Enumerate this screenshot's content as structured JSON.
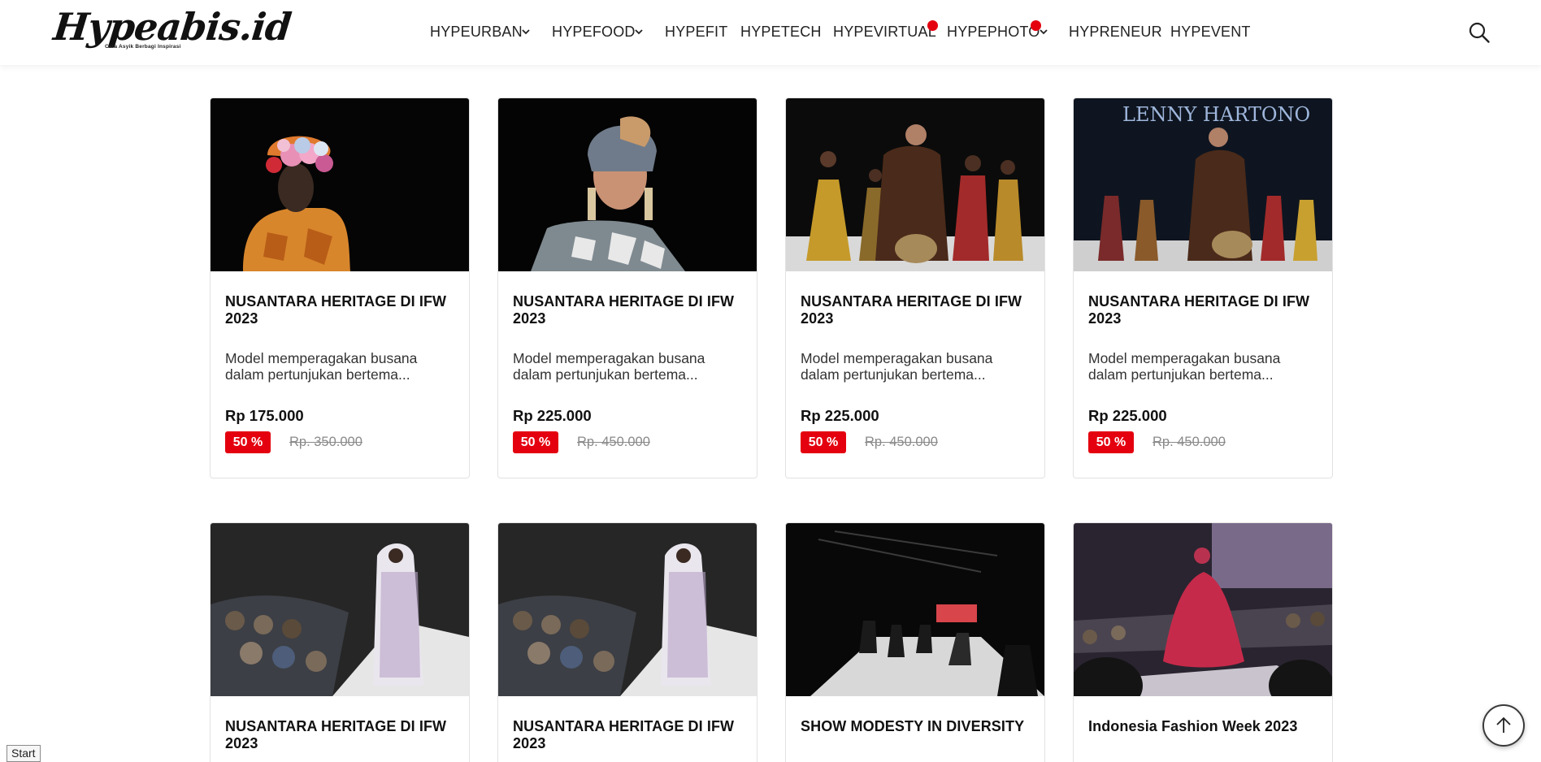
{
  "logo": {
    "text": "Hypeabis.id",
    "tagline": "Cara Asyik Berbagi Inspirasi"
  },
  "nav": [
    {
      "label": "HYPEURBAN",
      "dropdown": true,
      "badge": false
    },
    {
      "label": "HYPEFOOD",
      "dropdown": true,
      "badge": false
    },
    {
      "label": "HYPEFIT",
      "dropdown": false,
      "badge": false
    },
    {
      "label": "HYPETECH",
      "dropdown": false,
      "badge": false
    },
    {
      "label": "HYPEVIRTUAL",
      "dropdown": false,
      "badge": true
    },
    {
      "label": "HYPEPHOTO",
      "dropdown": true,
      "badge": true
    },
    {
      "label": "HYPRENEUR",
      "dropdown": false,
      "badge": false
    },
    {
      "label": "HYPEVENT",
      "dropdown": false,
      "badge": false
    }
  ],
  "icons": {
    "search": "search-icon",
    "scroll_top": "arrow-up-icon",
    "dropdown": "chevron-down-icon"
  },
  "colors": {
    "accent": "#e4000f",
    "text": "#111111",
    "muted": "#8a8a8a"
  },
  "products": [
    {
      "title": "NUSANTARA HERITAGE DI IFW 2023",
      "desc": "Model memperagakan busana dalam pertunjukan bertema...",
      "price": "Rp 175.000",
      "discount": "50 %",
      "old_price": "Rp. 350.000",
      "image": "model with floral hat and orange dress"
    },
    {
      "title": "NUSANTARA HERITAGE DI IFW 2023",
      "desc": "Model memperagakan busana dalam pertunjukan bertema...",
      "price": "Rp 225.000",
      "discount": "50 %",
      "old_price": "Rp. 450.000",
      "image": "model with headwrap and earrings"
    },
    {
      "title": "NUSANTARA HERITAGE DI IFW 2023",
      "desc": "Model memperagakan busana dalam pertunjukan bertema...",
      "price": "Rp 225.000",
      "discount": "50 %",
      "old_price": "Rp. 450.000",
      "image": "models on runway in gold and brown"
    },
    {
      "title": "NUSANTARA HERITAGE DI IFW 2023",
      "desc": "Model memperagakan busana dalam pertunjukan bertema...",
      "price": "Rp 225.000",
      "discount": "50 %",
      "old_price": "Rp. 450.000",
      "image": "runway in front of LENNY HARTONO sign",
      "image_text": "LENNY HARTONO"
    },
    {
      "title": "NUSANTARA HERITAGE DI IFW 2023",
      "image": "model in patterned robe beside audience"
    },
    {
      "title": "NUSANTARA HERITAGE DI IFW 2023",
      "image": "model in patterned robe beside audience"
    },
    {
      "title": "SHOW MODESTY IN DIVERSITY",
      "image": "dark runway with models"
    },
    {
      "title": "Indonesia Fashion Week 2023",
      "image": "model in pink dress on stage"
    }
  ],
  "taskbar": {
    "start_label": "Start"
  }
}
